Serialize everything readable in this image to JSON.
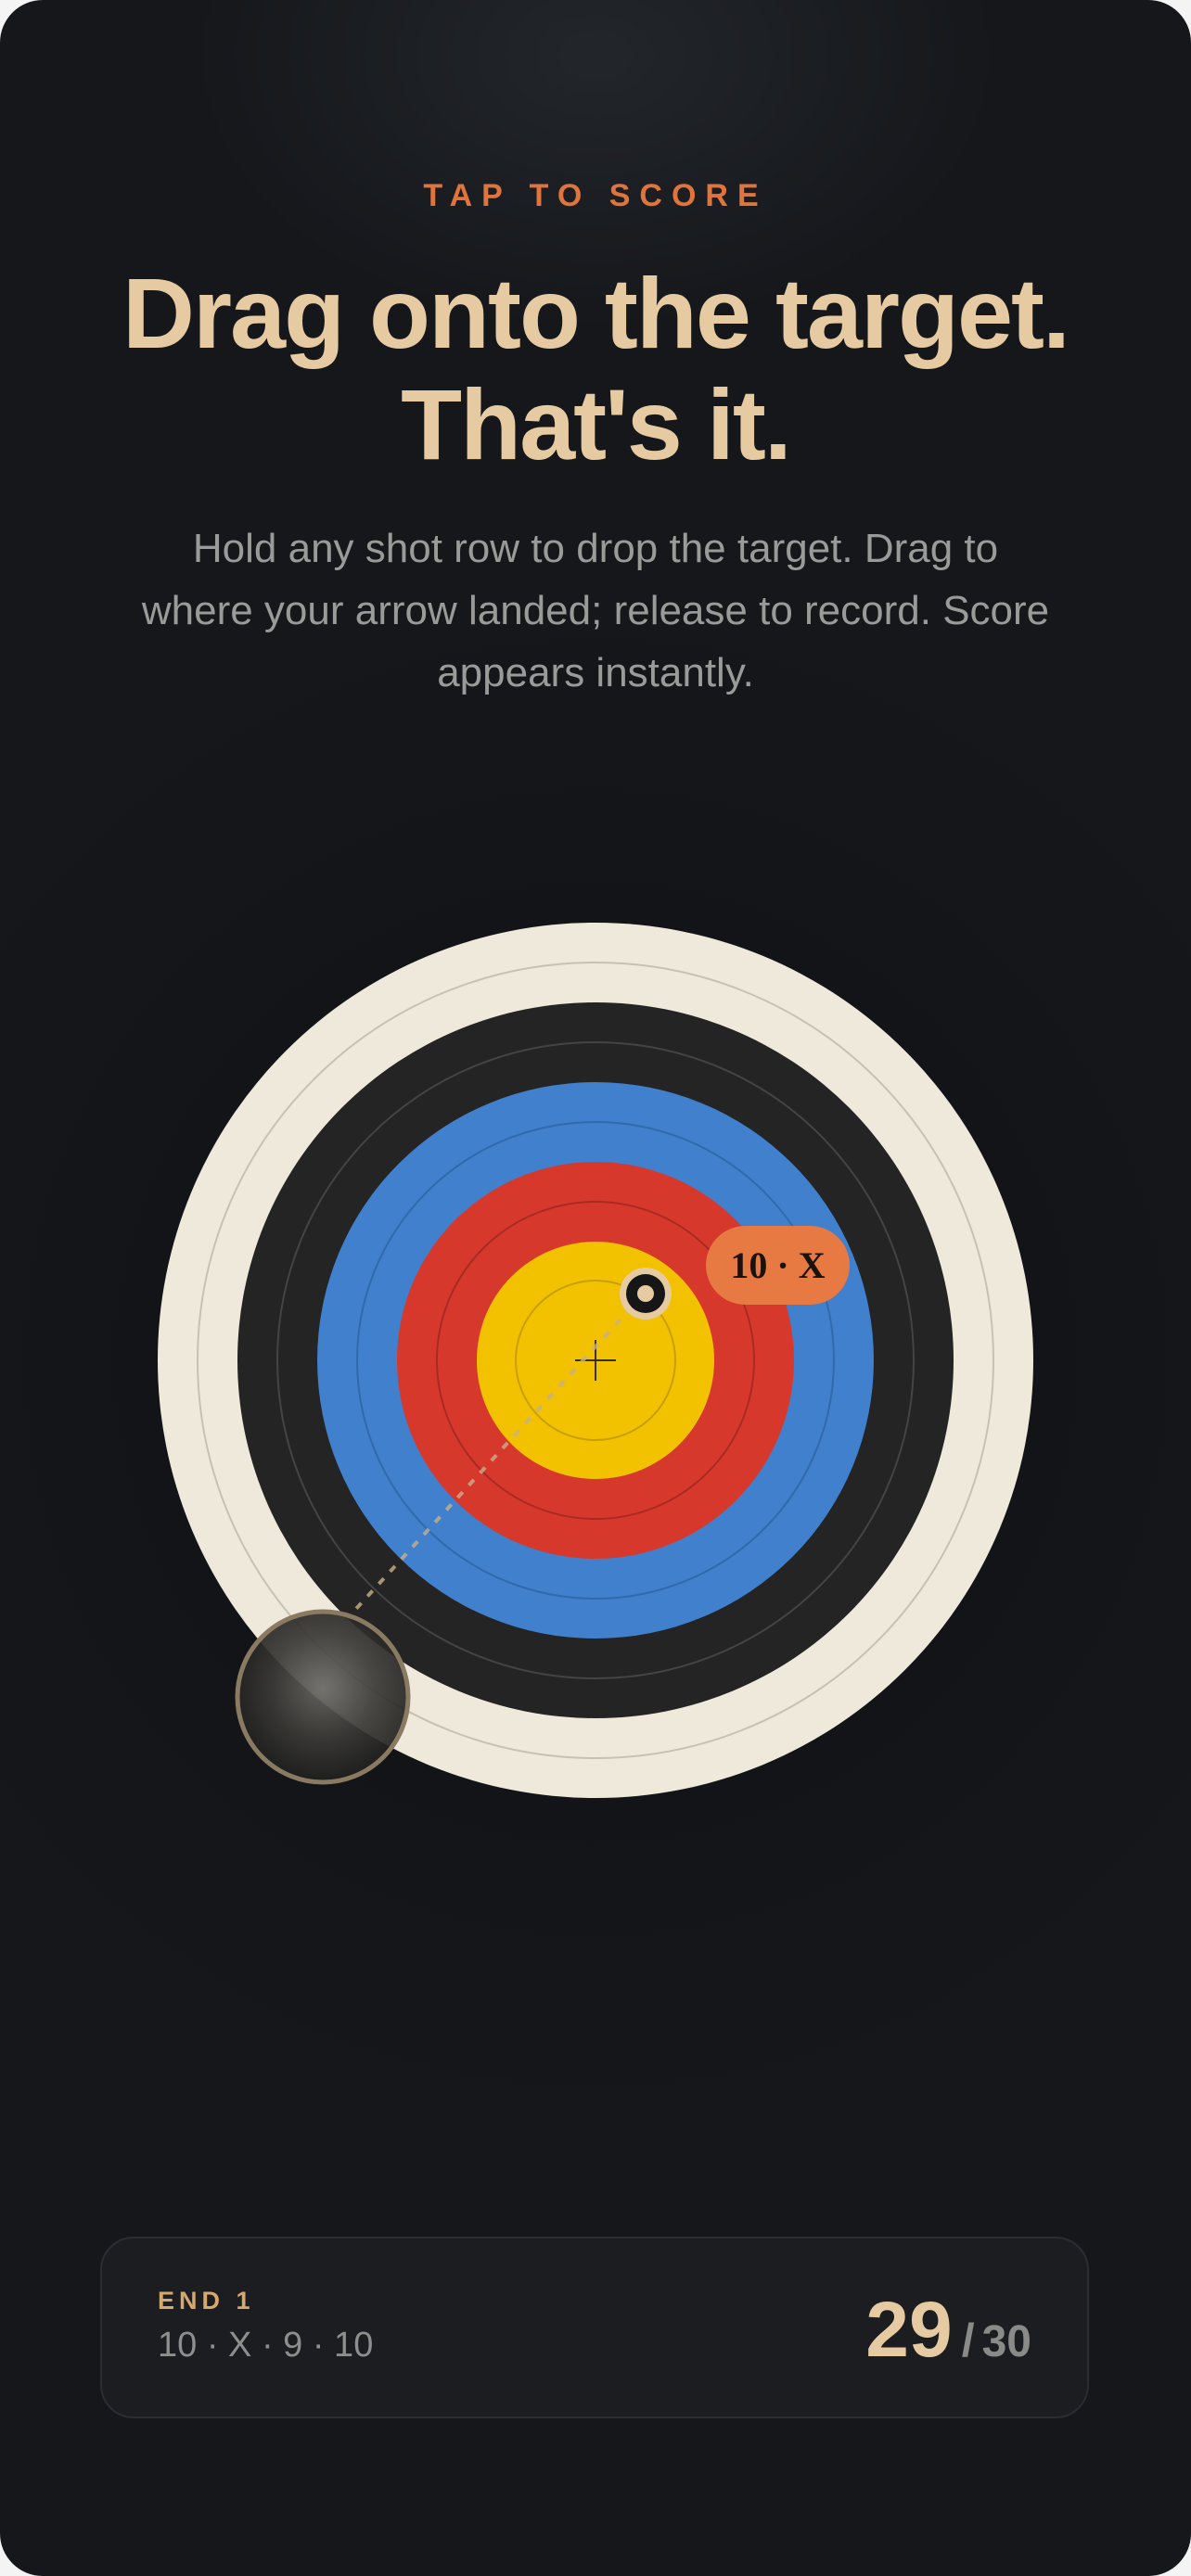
{
  "header": {
    "eyebrow": "TAP TO SCORE",
    "title_line1": "Drag onto the target.",
    "title_line2": "That's it.",
    "description": "Hold any shot row to drop the target. Drag to where your arrow landed; release to record. Score appears instantly."
  },
  "target": {
    "ring_colors": {
      "white": "#efe9dc",
      "black": "#242424",
      "blue": "#4080cc",
      "red": "#d6392c",
      "gold": "#f2c200"
    },
    "placed_arrow": {
      "score_label": "10 · X"
    }
  },
  "end_card": {
    "label": "END 1",
    "shots": "10 · X  ·  9  ·  10",
    "total": "29",
    "separator": "/",
    "max": "30"
  }
}
